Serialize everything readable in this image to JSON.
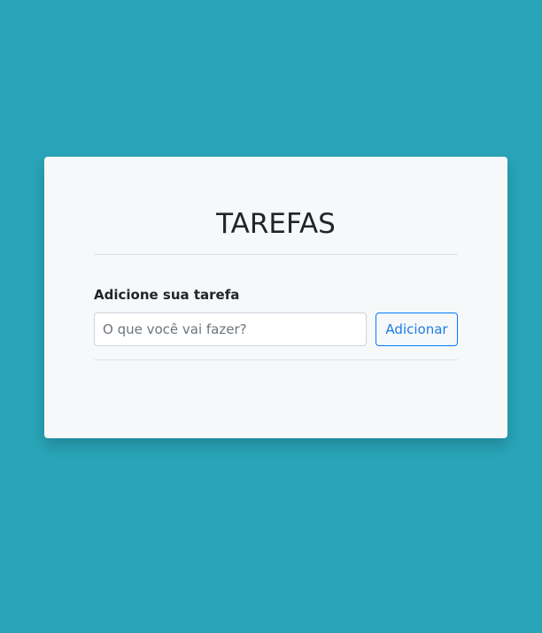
{
  "card": {
    "title": "TAREFAS",
    "form": {
      "label": "Adicione sua tarefa",
      "input": {
        "placeholder": "O que você vai fazer?",
        "value": ""
      },
      "add_button_label": "Adicionar"
    }
  },
  "colors": {
    "background": "#29a4b8",
    "card": "#f7f8f9",
    "accent": "#007bff"
  }
}
